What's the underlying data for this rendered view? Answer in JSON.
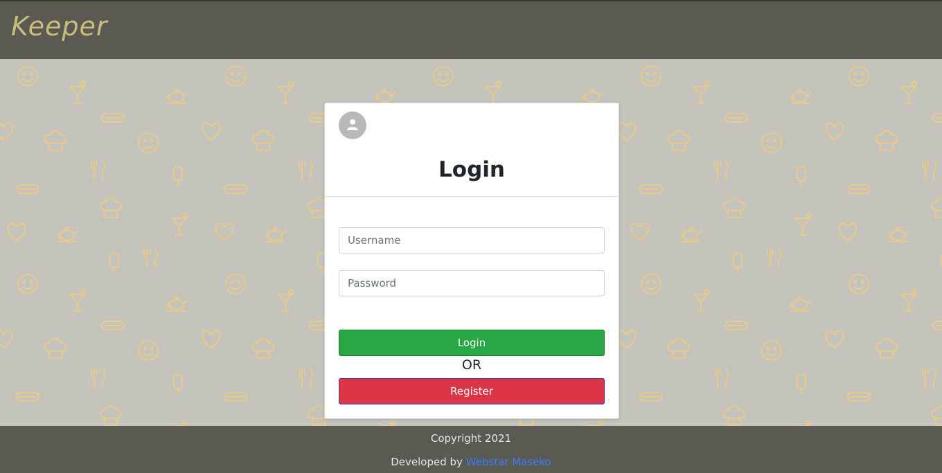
{
  "app": {
    "brand": "Keeper"
  },
  "login_card": {
    "title": "Login",
    "username_placeholder": "Username",
    "password_placeholder": "Password",
    "login_button": "Login",
    "or_text": "OR",
    "register_button": "Register",
    "avatar_icon": "user-icon"
  },
  "footer": {
    "copyright": "Copyright 2021",
    "developed_by": "Developed by",
    "developer_name": "Webstar Maseko"
  },
  "colors": {
    "header_bg": "#5a5a53",
    "page_bg": "#c4c4bd",
    "pattern": "#e8c98a",
    "login_green": "#28a745",
    "register_red": "#dc3545",
    "link_blue": "#3d7ef5"
  },
  "background_icons": [
    "smiley-icon",
    "cocktail-icon",
    "teapot-icon",
    "hotdog-icon",
    "chef-hat-icon",
    "heart-icon",
    "cutlery-icon",
    "popsicle-icon"
  ]
}
